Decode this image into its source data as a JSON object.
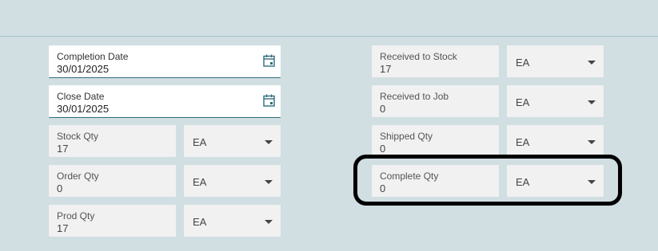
{
  "left": {
    "completion_date": {
      "label": "Completion Date",
      "value": "30/01/2025"
    },
    "close_date": {
      "label": "Close Date",
      "value": "30/01/2025"
    },
    "stock_qty": {
      "label": "Stock Qty",
      "value": "17",
      "uom": "EA"
    },
    "order_qty": {
      "label": "Order Qty",
      "value": "0",
      "uom": "EA"
    },
    "prod_qty": {
      "label": "Prod Qty",
      "value": "17",
      "uom": "EA"
    }
  },
  "right": {
    "received_to_stock": {
      "label": "Received to Stock",
      "value": "17",
      "uom": "EA"
    },
    "received_to_job": {
      "label": "Received to Job",
      "value": "0",
      "uom": "EA"
    },
    "shipped_qty": {
      "label": "Shipped Qty",
      "value": "0",
      "uom": "EA"
    },
    "complete_qty": {
      "label": "Complete Qty",
      "value": "0",
      "uom": "EA"
    }
  },
  "colors": {
    "background": "#d1dee2",
    "field": "#f1f1f1",
    "accent": "#2e6e7c",
    "highlight": "#000000"
  },
  "icons": {
    "date": "calendar-icon",
    "dropdown": "chevron-down-icon"
  }
}
